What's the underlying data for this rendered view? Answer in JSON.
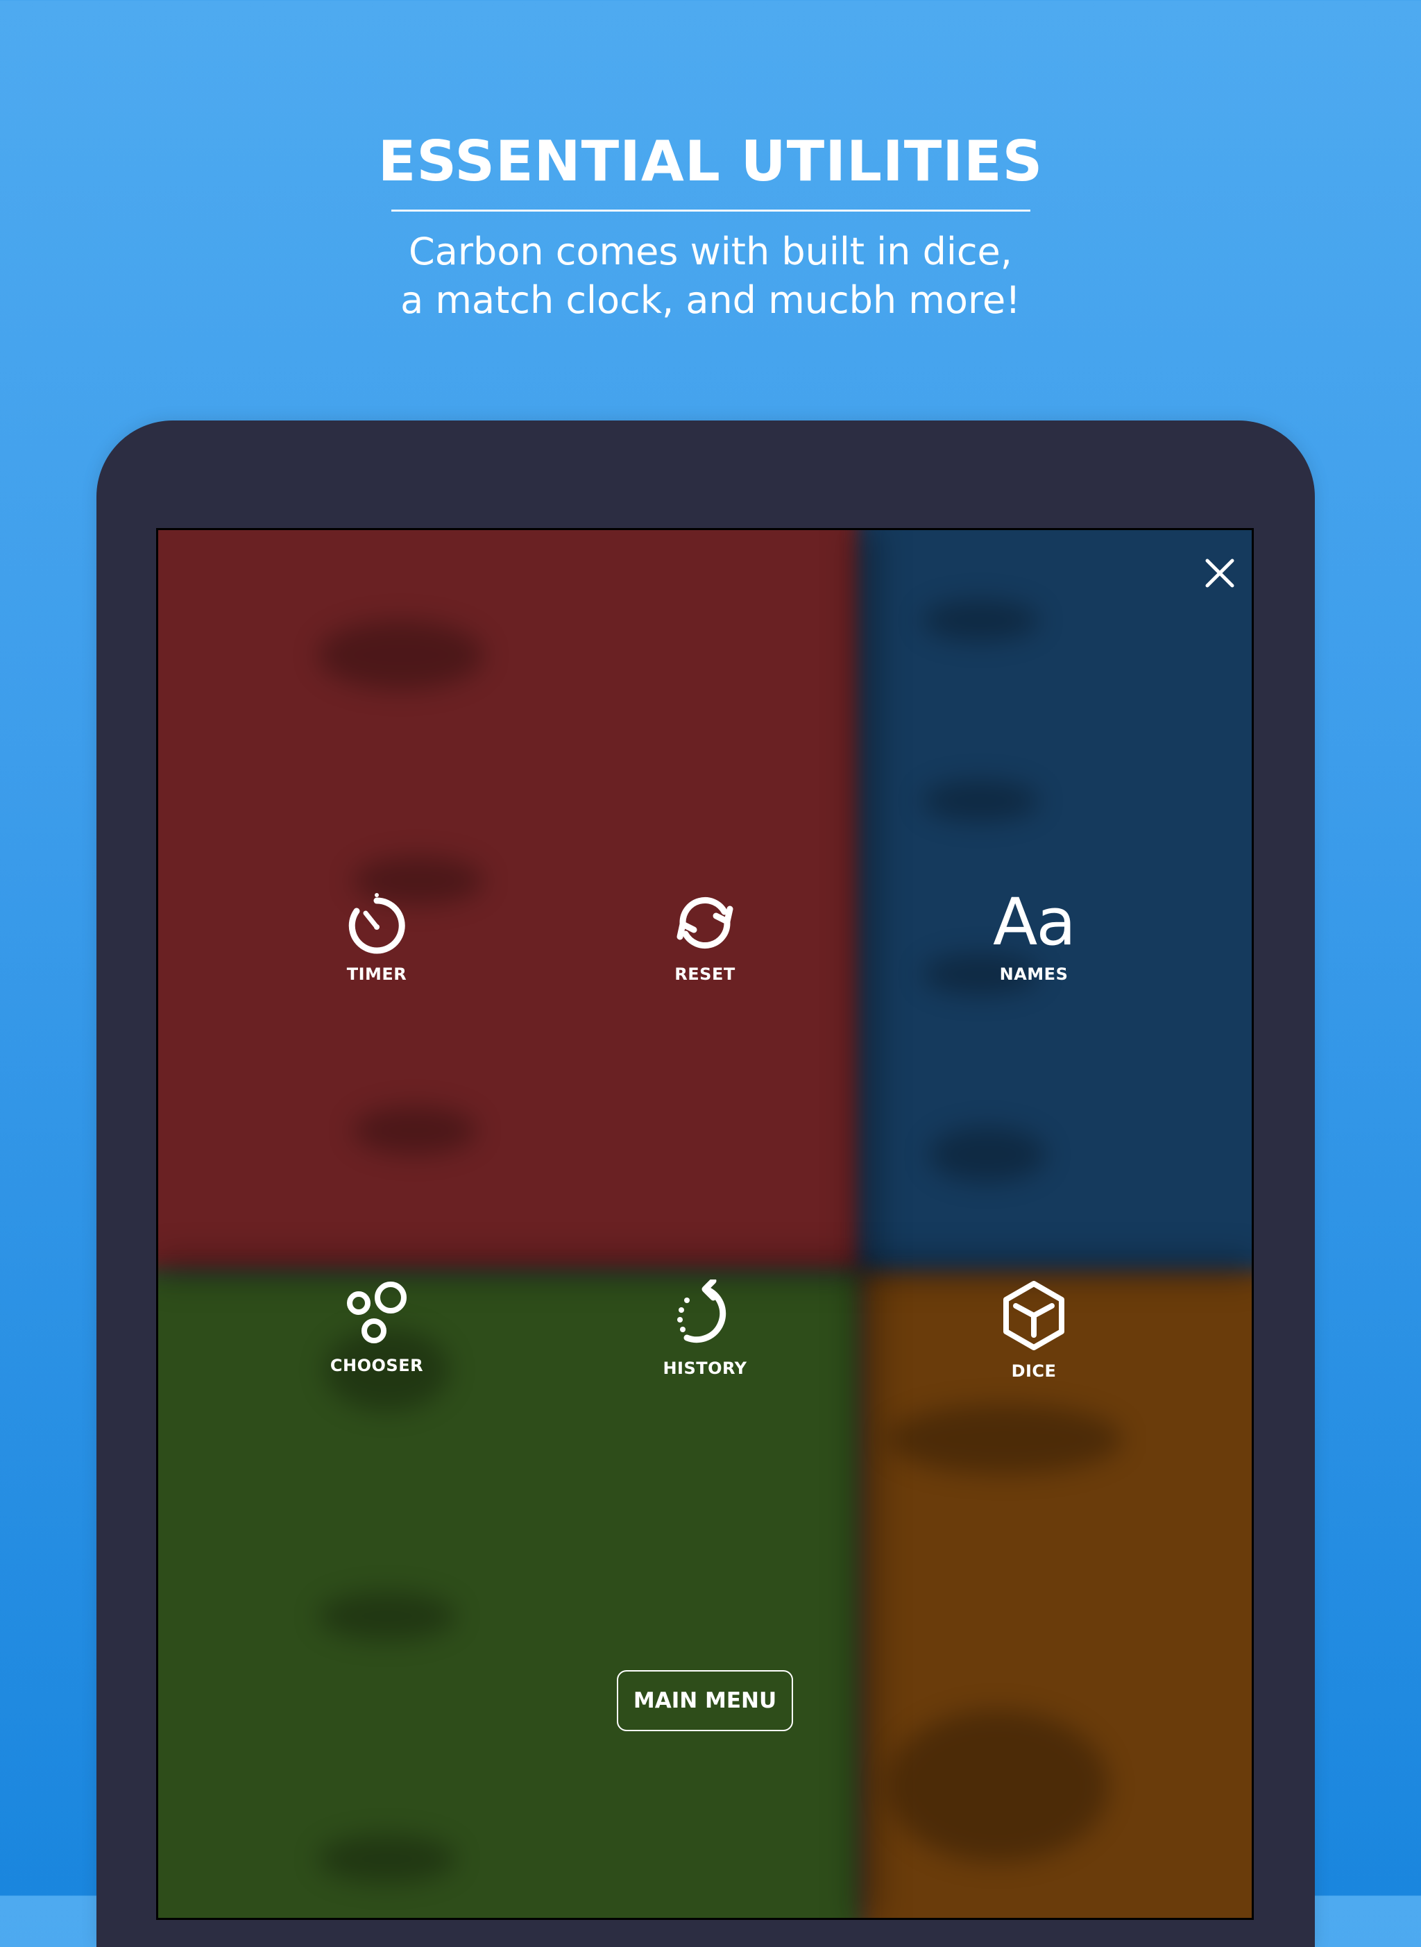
{
  "promo": {
    "headline": "ESSENTIAL UTILITIES",
    "subtitle_line1": "Carbon comes with built in dice,",
    "subtitle_line2": "a match clock, and mucbh more!"
  },
  "overlay": {
    "close_icon": "close-icon",
    "utilities": [
      {
        "label": "TIMER",
        "icon": "timer-icon"
      },
      {
        "label": "RESET",
        "icon": "reset-icon"
      },
      {
        "label": "NAMES",
        "icon": "names-icon",
        "glyph": "Aa"
      },
      {
        "label": "CHOOSER",
        "icon": "chooser-icon"
      },
      {
        "label": "HISTORY",
        "icon": "history-icon"
      },
      {
        "label": "DICE",
        "icon": "dice-icon"
      }
    ],
    "main_menu_label": "MAIN MENU"
  },
  "colors": {
    "background_top": "#4eaaf0",
    "background_bottom": "#1a86de",
    "device_frame": "#2c2d42",
    "player_red": "#6a2123",
    "player_blue": "#153a5d",
    "player_green": "#2e4d1a",
    "player_orange": "#6a3c0b",
    "overlay_text": "#ffffff"
  }
}
